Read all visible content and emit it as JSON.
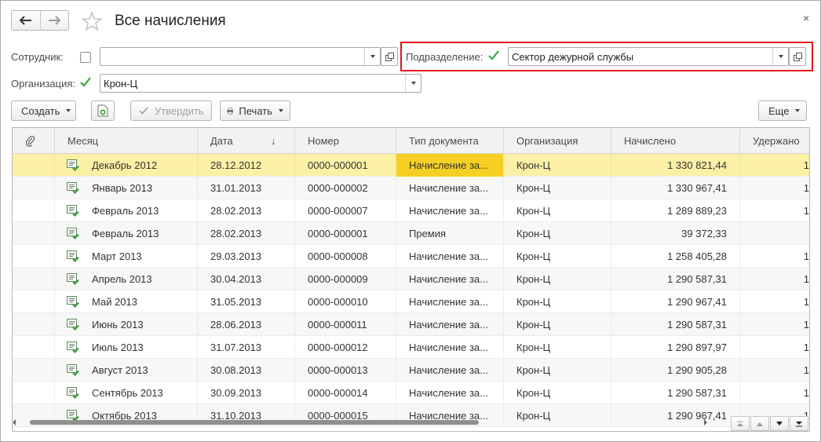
{
  "window": {
    "title": "Все начисления",
    "back_icon": "arrow-left-icon",
    "forward_icon": "arrow-right-icon",
    "close_symbol": "×"
  },
  "filters": {
    "employee_label": "Сотрудник:",
    "employee_checked": false,
    "employee_value": "",
    "department_label": "Подразделение:",
    "department_checked": true,
    "department_value": "Сектор дежурной службы",
    "organization_label": "Организация:",
    "organization_checked": true,
    "organization_value": "Крон-Ц"
  },
  "toolbar": {
    "create_label": "Создать",
    "approve_label": "Утвердить",
    "print_label": "Печать",
    "more_label": "Еще"
  },
  "table": {
    "columns": [
      "Месяц",
      "Дата",
      "Номер",
      "Тип документа",
      "Организация",
      "Начислено",
      "Удержано"
    ],
    "sort_indicator": "↓",
    "rows": [
      {
        "month": "Декабрь 2012",
        "date": "28.12.2012",
        "number": "0000-000001",
        "type": "Начисление за...",
        "org": "Крон-Ц",
        "accrued": "1 330 821,44",
        "withheld": "1",
        "selected": true
      },
      {
        "month": "Январь 2013",
        "date": "31.01.2013",
        "number": "0000-000002",
        "type": "Начисление за...",
        "org": "Крон-Ц",
        "accrued": "1 330 967,41",
        "withheld": "1"
      },
      {
        "month": "Февраль 2013",
        "date": "28.02.2013",
        "number": "0000-000007",
        "type": "Начисление за...",
        "org": "Крон-Ц",
        "accrued": "1 289 889,23",
        "withheld": "1"
      },
      {
        "month": "Февраль 2013",
        "date": "28.02.2013",
        "number": "0000-000001",
        "type": "Премия",
        "org": "Крон-Ц",
        "accrued": "39 372,33",
        "withheld": ""
      },
      {
        "month": "Март 2013",
        "date": "29.03.2013",
        "number": "0000-000008",
        "type": "Начисление за...",
        "org": "Крон-Ц",
        "accrued": "1 258 405,28",
        "withheld": "1"
      },
      {
        "month": "Апрель 2013",
        "date": "30.04.2013",
        "number": "0000-000009",
        "type": "Начисление за...",
        "org": "Крон-Ц",
        "accrued": "1 290 587,31",
        "withheld": "1"
      },
      {
        "month": "Май 2013",
        "date": "31.05.2013",
        "number": "0000-000010",
        "type": "Начисление за...",
        "org": "Крон-Ц",
        "accrued": "1 290 967,41",
        "withheld": "1"
      },
      {
        "month": "Июнь 2013",
        "date": "28.06.2013",
        "number": "0000-000011",
        "type": "Начисление за...",
        "org": "Крон-Ц",
        "accrued": "1 290 587,31",
        "withheld": "1"
      },
      {
        "month": "Июль 2013",
        "date": "31.07.2013",
        "number": "0000-000012",
        "type": "Начисление за...",
        "org": "Крон-Ц",
        "accrued": "1 290 897,97",
        "withheld": "1"
      },
      {
        "month": "Август 2013",
        "date": "30.08.2013",
        "number": "0000-000013",
        "type": "Начисление за...",
        "org": "Крон-Ц",
        "accrued": "1 290 905,28",
        "withheld": "1"
      },
      {
        "month": "Сентябрь 2013",
        "date": "30.09.2013",
        "number": "0000-000014",
        "type": "Начисление за...",
        "org": "Крон-Ц",
        "accrued": "1 290 587,31",
        "withheld": "1"
      },
      {
        "month": "Октябрь 2013",
        "date": "31.10.2013",
        "number": "0000-000015",
        "type": "Начисление за...",
        "org": "Крон-Ц",
        "accrued": "1 290 967,41",
        "withheld": "1"
      }
    ]
  },
  "colors": {
    "selected_row": "#fbf0a6",
    "selected_cell": "#f6cf23",
    "highlight_border": "#e3141c",
    "check_green": "#3aa63a"
  }
}
